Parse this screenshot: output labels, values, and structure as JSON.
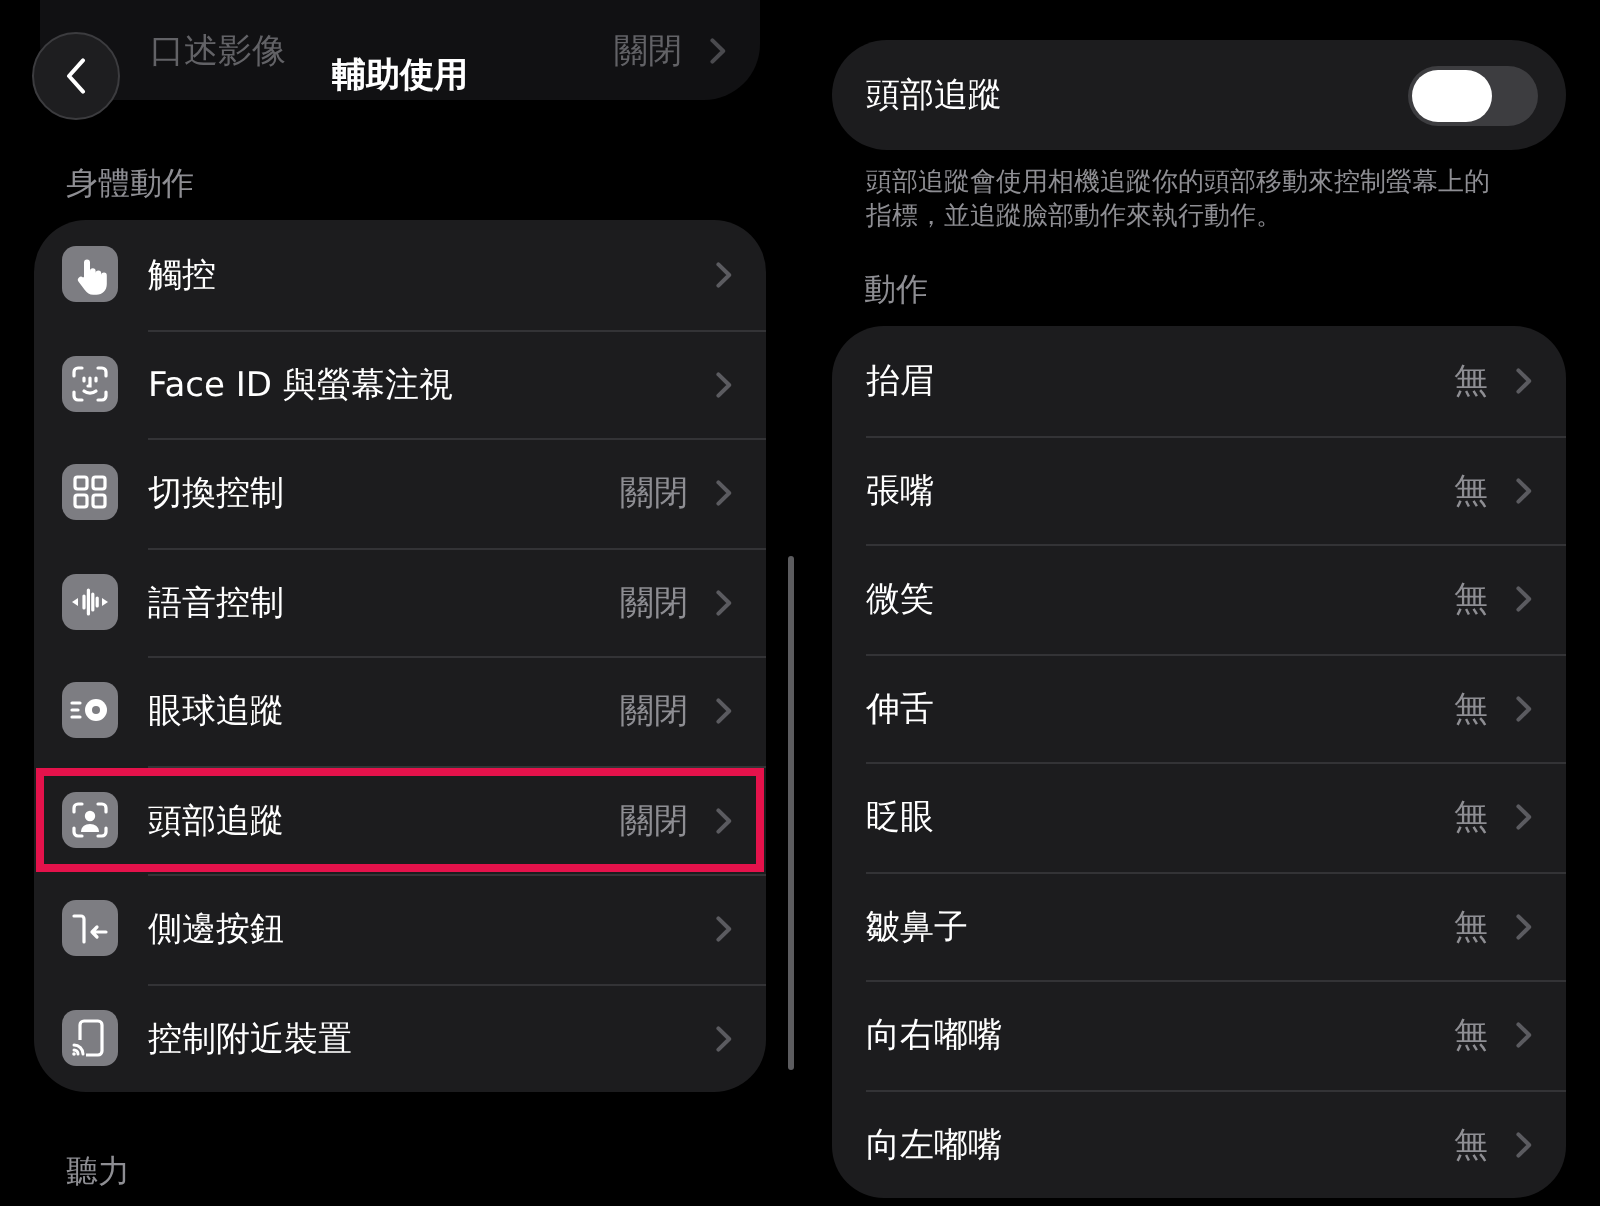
{
  "left_panel": {
    "header": {
      "title": "輔助使用",
      "row_behind": {
        "label": "口述影像",
        "value": "關閉"
      }
    },
    "sections": [
      {
        "title": "身體動作",
        "items": [
          {
            "label": "觸控",
            "highlighted": false
          },
          {
            "label": "Face ID 與螢幕注視",
            "highlighted": false
          },
          {
            "label": "切換控制",
            "value": "關閉",
            "highlighted": false
          },
          {
            "label": "語音控制",
            "value": "關閉",
            "highlighted": false
          },
          {
            "label": "眼球追蹤",
            "value": "關閉",
            "highlighted": false
          },
          {
            "label": "頭部追蹤",
            "value": "關閉",
            "highlighted": true
          },
          {
            "label": "側邊按鈕",
            "highlighted": false
          },
          {
            "label": "控制附近裝置",
            "highlighted": false
          }
        ]
      },
      {
        "title": "聽力"
      }
    ]
  },
  "right_panel": {
    "head_tracking": {
      "label": "頭部追蹤",
      "on": false
    },
    "description": "頭部追蹤會使用相機追蹤你的頭部移動來控制螢幕上的指標，並追蹤臉部動作來執行動作。",
    "sections": [
      {
        "title": "動作",
        "items": [
          {
            "label": "抬眉",
            "value": "無"
          },
          {
            "label": "張嘴",
            "value": "無"
          },
          {
            "label": "微笑",
            "value": "無"
          },
          {
            "label": "伸舌",
            "value": "無"
          },
          {
            "label": "眨眼",
            "value": "無"
          },
          {
            "label": "皺鼻子",
            "value": "無"
          },
          {
            "label": "向右嘟嘴",
            "value": "無"
          },
          {
            "label": "向左嘟嘴",
            "value": "無"
          }
        ]
      }
    ]
  }
}
